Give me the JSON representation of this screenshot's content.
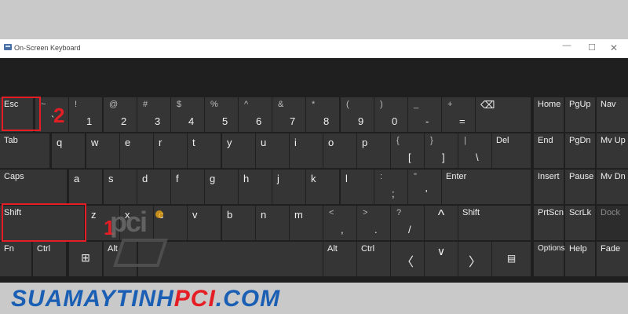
{
  "window": {
    "title": "On-Screen Keyboard",
    "min": "—",
    "max": "☐",
    "close": "✕"
  },
  "annotations": {
    "one": "1",
    "two": "2"
  },
  "watermark": {
    "text": "pci"
  },
  "brand": {
    "part1": "SUAMAYTINH",
    "part2": "PCI",
    "part3": ".COM"
  },
  "keys": {
    "esc": "Esc",
    "backtick": "`",
    "tilde": "~",
    "d1": "1",
    "s1": "!",
    "d2": "2",
    "s2": "@",
    "d3": "3",
    "s3": "#",
    "d4": "4",
    "s4": "$",
    "d5": "5",
    "s5": "%",
    "d6": "6",
    "s6": "^",
    "d7": "7",
    "s7": "&",
    "d8": "8",
    "s8": "*",
    "d9": "9",
    "s9": "(",
    "d0": "0",
    "s0": ")",
    "minus": "-",
    "underscore": "_",
    "equals": "=",
    "plus": "+",
    "backspace": "⌫",
    "home": "Home",
    "pgup": "PgUp",
    "nav": "Nav",
    "tab": "Tab",
    "q": "q",
    "w": "w",
    "e": "e",
    "r": "r",
    "t": "t",
    "y": "y",
    "u": "u",
    "i": "i",
    "o": "o",
    "p": "p",
    "lbracket": "[",
    "lbrace": "{",
    "rbracket": "]",
    "rbrace": "}",
    "backslash": "\\",
    "pipe": "|",
    "del": "Del",
    "end": "End",
    "pgdn": "PgDn",
    "mvup": "Mv Up",
    "caps": "Caps",
    "a": "a",
    "s": "s",
    "d": "d",
    "f": "f",
    "g": "g",
    "h": "h",
    "j": "j",
    "k": "k",
    "l": "l",
    "semicolon": ";",
    "colon": ":",
    "quote": "'",
    "dquote": "\"",
    "enter": "Enter",
    "insert": "Insert",
    "pause": "Pause",
    "mvdn": "Mv Dn",
    "shift": "Shift",
    "z": "z",
    "x": "x",
    "c": "c",
    "v": "v",
    "b": "b",
    "n": "n",
    "m": "m",
    "comma": ",",
    "lt": "<",
    "period": ".",
    "gt": ">",
    "slash": "/",
    "question": "?",
    "up": "^",
    "rshift": "Shift",
    "prtscn": "PrtScn",
    "scrlk": "ScrLk",
    "dock": "Dock",
    "fn": "Fn",
    "ctrl": "Ctrl",
    "win": "⊞",
    "alt": "Alt",
    "altr": "Alt",
    "ctrlr": "Ctrl",
    "left": "〈",
    "down": "∨",
    "right": "〉",
    "menu": "▤",
    "options": "Options",
    "help": "Help",
    "fade": "Fade"
  }
}
